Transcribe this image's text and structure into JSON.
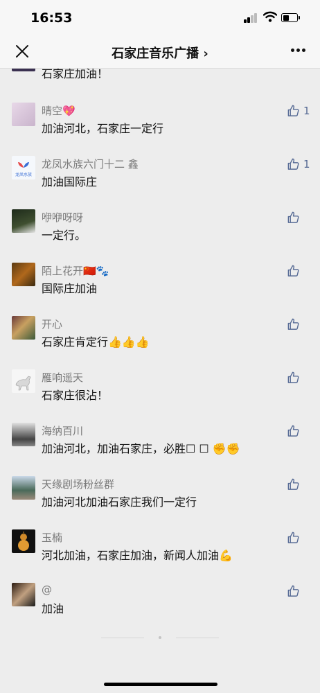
{
  "status": {
    "time": "16:53"
  },
  "header": {
    "title": "石家庄音乐广播 ›"
  },
  "partial_comment": {
    "text": "石家庄加油！"
  },
  "comments": [
    {
      "name": "晴空💖",
      "text": "加油河北，石家庄一定行",
      "likes": "1"
    },
    {
      "name": "龙凤水族六门十二 鑫",
      "text": "加油国际庄",
      "likes": "1",
      "avatar_text": "龙凤水族"
    },
    {
      "name": "咿咿呀呀",
      "text": "一定行。",
      "likes": ""
    },
    {
      "name": "陌上花开🇨🇳🐾",
      "text": "国际庄加油",
      "likes": ""
    },
    {
      "name": "开心",
      "text": "石家庄肯定行👍👍👍",
      "likes": ""
    },
    {
      "name": "雁响遥天",
      "text": "石家庄很沾！",
      "likes": ""
    },
    {
      "name": "海纳百川",
      "text": "加油河北，加油石家庄，必胜☐ ☐ ✊✊",
      "likes": ""
    },
    {
      "name": "天缘剧场粉丝群",
      "text": "加油河北加油石家庄我们一定行",
      "likes": ""
    },
    {
      "name": "玉楠",
      "text": "河北加油，石家庄加油，新闻人加油💪",
      "likes": ""
    },
    {
      "name": "@",
      "text": "加油",
      "likes": ""
    }
  ],
  "icons": {
    "close": "close-icon",
    "more": "more-icon",
    "like": "thumbs-up-icon"
  },
  "colors": {
    "background": "#ededed",
    "like": "#576b95",
    "name": "#7a7a7a"
  }
}
